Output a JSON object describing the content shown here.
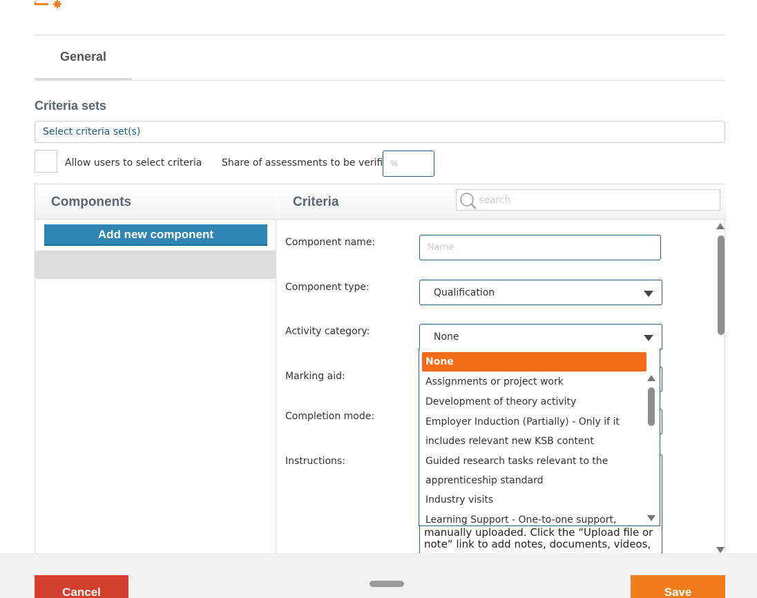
{
  "tabs": [
    {
      "label": "General"
    }
  ],
  "criteria_sets": {
    "title": "Criteria sets",
    "select_label": "Select criteria set(s)",
    "allow_label": "Allow users to select criteria",
    "share_label": "Share of assessments to be verified",
    "share_placeholder": "%"
  },
  "components": {
    "header": "Components",
    "add_button": "Add new component"
  },
  "criteria": {
    "header": "Criteria",
    "search_placeholder": "search"
  },
  "form": {
    "name_label": "Component name:",
    "name_placeholder": "Name",
    "type_label": "Component type:",
    "type_value": "Qualification",
    "activity_label": "Activity category:",
    "activity_value": "None",
    "marking_label": "Marking aid:",
    "completion_label": "Completion mode:",
    "instructions_label": "Instructions:",
    "instructions_text": "manually uploaded. Click the “Upload file or note” link to add notes, documents, videos,"
  },
  "dropdown": {
    "options": [
      {
        "lines": [
          "None"
        ],
        "selected": true
      },
      {
        "lines": [
          "Assignments or project work"
        ]
      },
      {
        "lines": [
          "Development of theory activity"
        ]
      },
      {
        "lines": [
          "Employer Induction (Partially) - Only if it",
          "includes relevant new KSB content"
        ]
      },
      {
        "lines": [
          "Guided research tasks relevant to the",
          "apprenticeship standard"
        ]
      },
      {
        "lines": [
          "Industry visits"
        ]
      },
      {
        "lines": [
          "Learning Support - One-to-one support,"
        ]
      }
    ]
  },
  "footer": {
    "cancel": "Cancel",
    "save": "Save"
  },
  "colors": {
    "accent_orange": "#f26a17",
    "cancel_red": "#d5402e",
    "primary_blue": "#2f86b4"
  }
}
